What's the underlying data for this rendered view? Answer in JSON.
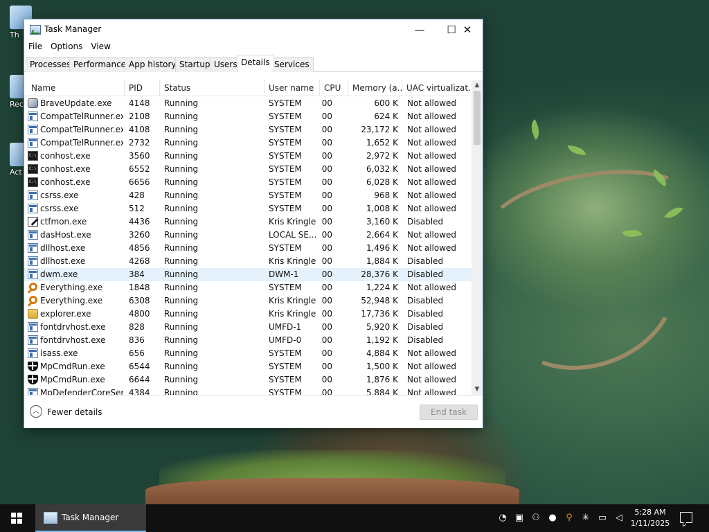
{
  "desktop": {
    "icons": [
      {
        "label": "Th"
      },
      {
        "label": "Recy"
      },
      {
        "label": "Act"
      }
    ]
  },
  "window": {
    "title": "Task Manager",
    "controls": {
      "minimize": "—",
      "maximize": "☐",
      "close": "✕"
    }
  },
  "menu": [
    "File",
    "Options",
    "View"
  ],
  "tabs": [
    "Processes",
    "Performance",
    "App history",
    "Startup",
    "Users",
    "Details",
    "Services"
  ],
  "active_tab": "Details",
  "columns": [
    "Name",
    "PID",
    "Status",
    "User name",
    "CPU",
    "Memory (a...",
    "UAC virtualizat..."
  ],
  "rows": [
    {
      "icon": "brave",
      "name": "BraveUpdate.exe",
      "pid": "4148",
      "status": "Running",
      "user": "SYSTEM",
      "cpu": "00",
      "mem": "600 K",
      "uac": "Not allowed"
    },
    {
      "icon": "app",
      "name": "CompatTelRunner.exe",
      "pid": "2108",
      "status": "Running",
      "user": "SYSTEM",
      "cpu": "00",
      "mem": "624 K",
      "uac": "Not allowed"
    },
    {
      "icon": "app",
      "name": "CompatTelRunner.exe",
      "pid": "4108",
      "status": "Running",
      "user": "SYSTEM",
      "cpu": "00",
      "mem": "23,172 K",
      "uac": "Not allowed"
    },
    {
      "icon": "app",
      "name": "CompatTelRunner.exe",
      "pid": "2732",
      "status": "Running",
      "user": "SYSTEM",
      "cpu": "00",
      "mem": "1,652 K",
      "uac": "Not allowed"
    },
    {
      "icon": "console",
      "name": "conhost.exe",
      "pid": "3560",
      "status": "Running",
      "user": "SYSTEM",
      "cpu": "00",
      "mem": "2,972 K",
      "uac": "Not allowed"
    },
    {
      "icon": "console",
      "name": "conhost.exe",
      "pid": "6552",
      "status": "Running",
      "user": "SYSTEM",
      "cpu": "00",
      "mem": "6,032 K",
      "uac": "Not allowed"
    },
    {
      "icon": "console",
      "name": "conhost.exe",
      "pid": "6656",
      "status": "Running",
      "user": "SYSTEM",
      "cpu": "00",
      "mem": "6,028 K",
      "uac": "Not allowed"
    },
    {
      "icon": "app",
      "name": "csrss.exe",
      "pid": "428",
      "status": "Running",
      "user": "SYSTEM",
      "cpu": "00",
      "mem": "968 K",
      "uac": "Not allowed"
    },
    {
      "icon": "app",
      "name": "csrss.exe",
      "pid": "512",
      "status": "Running",
      "user": "SYSTEM",
      "cpu": "00",
      "mem": "1,008 K",
      "uac": "Not allowed"
    },
    {
      "icon": "pen",
      "name": "ctfmon.exe",
      "pid": "4436",
      "status": "Running",
      "user": "Kris Kringle",
      "cpu": "00",
      "mem": "3,160 K",
      "uac": "Disabled"
    },
    {
      "icon": "app",
      "name": "dasHost.exe",
      "pid": "3260",
      "status": "Running",
      "user": "LOCAL SE...",
      "cpu": "00",
      "mem": "2,664 K",
      "uac": "Not allowed"
    },
    {
      "icon": "app",
      "name": "dllhost.exe",
      "pid": "4856",
      "status": "Running",
      "user": "SYSTEM",
      "cpu": "00",
      "mem": "1,496 K",
      "uac": "Not allowed"
    },
    {
      "icon": "app",
      "name": "dllhost.exe",
      "pid": "4268",
      "status": "Running",
      "user": "Kris Kringle",
      "cpu": "00",
      "mem": "1,884 K",
      "uac": "Disabled"
    },
    {
      "icon": "app",
      "name": "dwm.exe",
      "pid": "384",
      "status": "Running",
      "user": "DWM-1",
      "cpu": "00",
      "mem": "28,376 K",
      "uac": "Disabled",
      "selected": true
    },
    {
      "icon": "search",
      "name": "Everything.exe",
      "pid": "1848",
      "status": "Running",
      "user": "SYSTEM",
      "cpu": "00",
      "mem": "1,224 K",
      "uac": "Not allowed"
    },
    {
      "icon": "search",
      "name": "Everything.exe",
      "pid": "6308",
      "status": "Running",
      "user": "Kris Kringle",
      "cpu": "00",
      "mem": "52,948 K",
      "uac": "Disabled"
    },
    {
      "icon": "folder",
      "name": "explorer.exe",
      "pid": "4800",
      "status": "Running",
      "user": "Kris Kringle",
      "cpu": "00",
      "mem": "17,736 K",
      "uac": "Disabled"
    },
    {
      "icon": "app",
      "name": "fontdrvhost.exe",
      "pid": "828",
      "status": "Running",
      "user": "UMFD-1",
      "cpu": "00",
      "mem": "5,920 K",
      "uac": "Disabled"
    },
    {
      "icon": "app",
      "name": "fontdrvhost.exe",
      "pid": "836",
      "status": "Running",
      "user": "UMFD-0",
      "cpu": "00",
      "mem": "1,192 K",
      "uac": "Disabled"
    },
    {
      "icon": "app",
      "name": "lsass.exe",
      "pid": "656",
      "status": "Running",
      "user": "SYSTEM",
      "cpu": "00",
      "mem": "4,884 K",
      "uac": "Not allowed"
    },
    {
      "icon": "shield",
      "name": "MpCmdRun.exe",
      "pid": "6544",
      "status": "Running",
      "user": "SYSTEM",
      "cpu": "00",
      "mem": "1,500 K",
      "uac": "Not allowed"
    },
    {
      "icon": "shield",
      "name": "MpCmdRun.exe",
      "pid": "6644",
      "status": "Running",
      "user": "SYSTEM",
      "cpu": "00",
      "mem": "1,876 K",
      "uac": "Not allowed"
    },
    {
      "icon": "app",
      "name": "MpDefenderCoreSer...",
      "pid": "4384",
      "status": "Running",
      "user": "SYSTEM",
      "cpu": "00",
      "mem": "5,884 K",
      "uac": "Not allowed"
    }
  ],
  "footer": {
    "fewer_details": "Fewer details",
    "end_task": "End task"
  },
  "taskbar": {
    "app_label": "Task Manager",
    "time": "5:28 AM",
    "date": "1/11/2025"
  }
}
